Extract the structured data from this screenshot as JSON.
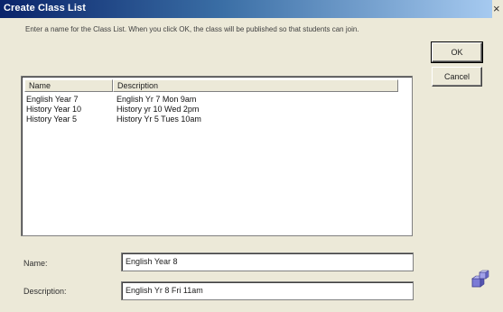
{
  "window": {
    "title": "Create Class List",
    "close_glyph": "×"
  },
  "instructions": "Enter a name for the Class List. When you click OK, the class will be published so that students can join.",
  "buttons": {
    "ok": "OK",
    "cancel": "Cancel"
  },
  "class_table": {
    "columns": [
      "Name",
      "Description"
    ],
    "rows": [
      {
        "name": "English Year 7",
        "description": "English Yr 7 Mon 9am"
      },
      {
        "name": "History Year 10",
        "description": "History yr 10 Wed 2pm"
      },
      {
        "name": "History Year 5",
        "description": "History Yr 5 Tues 10am"
      }
    ]
  },
  "form": {
    "name_label": "Name:",
    "name_value": "English Year 8",
    "description_label": "Description:",
    "description_value": "English Yr 8 Fri 11am"
  },
  "icons": {
    "decorative": "cubes-icon"
  },
  "colors": {
    "titlebar_start": "#0a246a",
    "titlebar_end": "#a6caf0",
    "dialog_bg": "#ece9d8"
  }
}
